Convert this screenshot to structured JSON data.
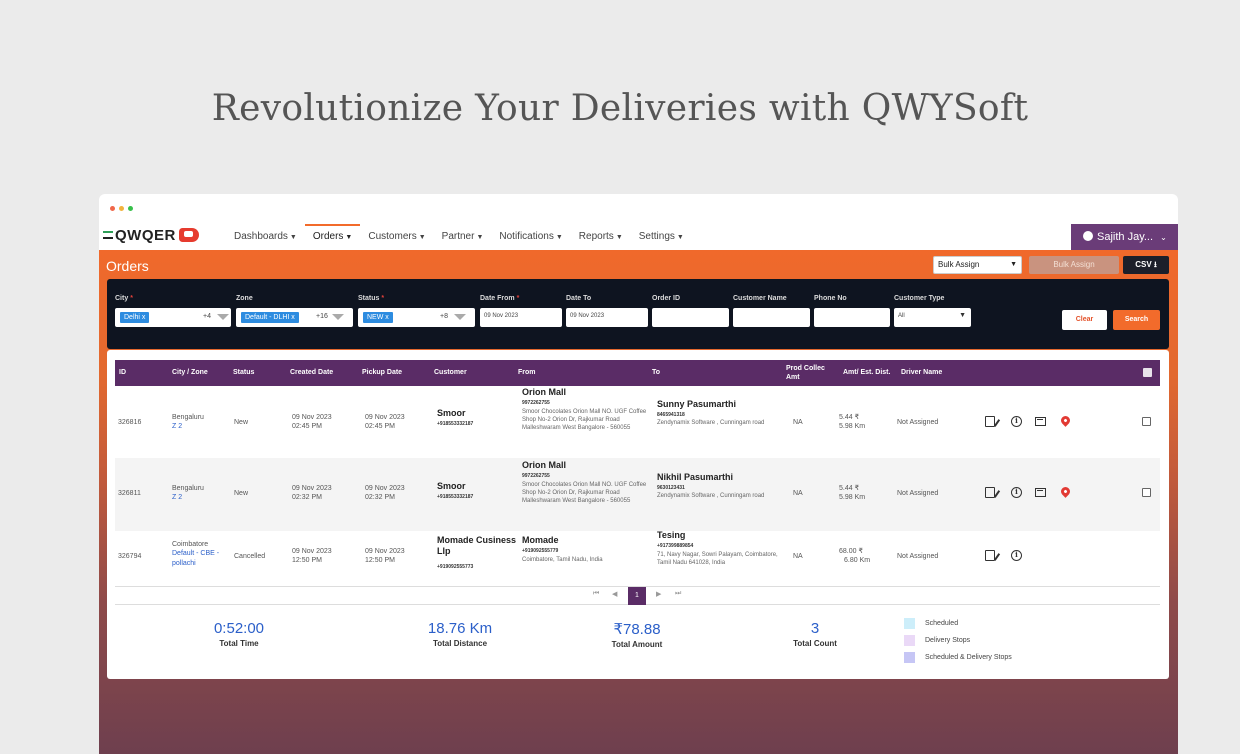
{
  "hero": {
    "title": "Revolutionize Your Deliveries with QWYSoft"
  },
  "window": {
    "dot_colors": [
      "#f0674a",
      "#f2b33d",
      "#37c04a"
    ]
  },
  "navbar": {
    "logo": "QWQER",
    "items": [
      {
        "label": "Dashboards",
        "active": false
      },
      {
        "label": "Orders",
        "active": true
      },
      {
        "label": "Customers",
        "active": false
      },
      {
        "label": "Partner",
        "active": false
      },
      {
        "label": "Notifications",
        "active": false
      },
      {
        "label": "Reports",
        "active": false
      },
      {
        "label": "Settings",
        "active": false
      }
    ],
    "user": "Sajith Jay...",
    "caret": "⌄"
  },
  "orders_bar": {
    "title": "Orders",
    "bulk_select_value": "Bulk Assign",
    "bulk_button": "Bulk Assign",
    "csv_button": "CSV",
    "csv_icon": "⭳"
  },
  "filters": {
    "city": {
      "label": "City",
      "required": "*",
      "chip": "Delhi x",
      "more": "+4"
    },
    "zone": {
      "label": "Zone",
      "chip": "Default - DLHI x",
      "more": "+16"
    },
    "status": {
      "label": "Status",
      "required": "*",
      "chip": "NEW x",
      "more": "+8"
    },
    "date_from": {
      "label": "Date From",
      "required": "*",
      "value": "09 Nov 2023"
    },
    "date_to": {
      "label": "Date To",
      "value": "09 Nov 2023"
    },
    "order_id": {
      "label": "Order ID",
      "value": ""
    },
    "customer_name": {
      "label": "Customer Name",
      "value": ""
    },
    "phone_no": {
      "label": "Phone No",
      "value": ""
    },
    "customer_type": {
      "label": "Customer Type",
      "value": "All"
    },
    "clear": "Clear",
    "search": "Search"
  },
  "table": {
    "headers": {
      "id": "ID",
      "city_zone": "City / Zone",
      "status": "Status",
      "created": "Created Date",
      "pickup": "Pickup Date",
      "customer": "Customer",
      "from": "From",
      "to": "To",
      "prod_line1": "Prod Collec",
      "prod_line2": "Amt",
      "amt": "Amt/ Est. Dist.",
      "driver": "Driver Name"
    },
    "rows": [
      {
        "id": "326816",
        "city": "Bengaluru",
        "zone": "Z 2",
        "status": "New",
        "created_date": "09 Nov 2023",
        "created_time": "02:45 PM",
        "pickup_date": "09 Nov 2023",
        "pickup_time": "02:45 PM",
        "customer": "Smoor",
        "customer_phone": "+918553332187",
        "from_name": "Orion Mall",
        "from_phone": "9972262755",
        "from_addr": "Smoor Chocolates Orion Mall NO. UGF Coffee Shop No-2 Orion Dr, Rajkumar Road Malleshwaram West Bangalore - 560055",
        "to_name": "Sunny Pasumarthi",
        "to_phone": "8465941318",
        "to_addr": "Zendynamix Software , Cunningam road",
        "prod_amt": "NA",
        "amount": "5.44 ₹",
        "distance": "5.98 Km",
        "driver": "Not Assigned"
      },
      {
        "id": "326811",
        "city": "Bengaluru",
        "zone": "Z 2",
        "status": "New",
        "created_date": "09 Nov 2023",
        "created_time": "02:32 PM",
        "pickup_date": "09 Nov 2023",
        "pickup_time": "02:32 PM",
        "customer": "Smoor",
        "customer_phone": "+918553332187",
        "from_name": "Orion Mall",
        "from_phone": "9972262755",
        "from_addr": "Smoor Chocolates Orion Mall NO. UGF Coffee Shop No-2 Orion Dr, Rajkumar Road Malleshwaram West Bangalore - 560055",
        "to_name": "Nikhil Pasumarthi",
        "to_phone": "9630123431",
        "to_addr": "Zendynamix Software , Cunningam road",
        "prod_amt": "NA",
        "amount": "5.44 ₹",
        "distance": "5.98 Km",
        "driver": "Not Assigned"
      },
      {
        "id": "326794",
        "city": "Coimbatore",
        "zone": "Default - CBE - pollachi",
        "status": "Cancelled",
        "created_date": "09 Nov 2023",
        "created_time": "12:50 PM",
        "pickup_date": "09 Nov 2023",
        "pickup_time": "12:50 PM",
        "customer": "Momade Cusiness Llp",
        "customer_phone": "+919092555773",
        "from_name": "Momade",
        "from_phone": "+919092555779",
        "from_addr": "Coimbatore, Tamil Nadu, India",
        "to_name": "Tesing",
        "to_phone": "+917399889854",
        "to_addr": "71, Navy Nagar, Sowri Palayam, Coimbatore, Tamil Nadu 641028, India",
        "prod_amt": "NA",
        "amount": "68.00 ₹",
        "distance": "6.80 Km",
        "driver": "Not Assigned"
      }
    ]
  },
  "pagination": {
    "first": "⏮",
    "prev": "◀",
    "current": "1",
    "next": "▶",
    "last": "⏭"
  },
  "stats": [
    {
      "value": "0:52:00",
      "label": "Total Time"
    },
    {
      "value": "18.76 Km",
      "label": "Total Distance"
    },
    {
      "value": "₹78.88",
      "label": "Total Amount"
    },
    {
      "value": "3",
      "label": "Total Count"
    }
  ],
  "legend": [
    {
      "label": "Scheduled",
      "color": "#cdeefa"
    },
    {
      "label": "Delivery Stops",
      "color": "#ead9f7"
    },
    {
      "label": "Scheduled & Delivery Stops",
      "color": "#c6c6f5"
    }
  ]
}
